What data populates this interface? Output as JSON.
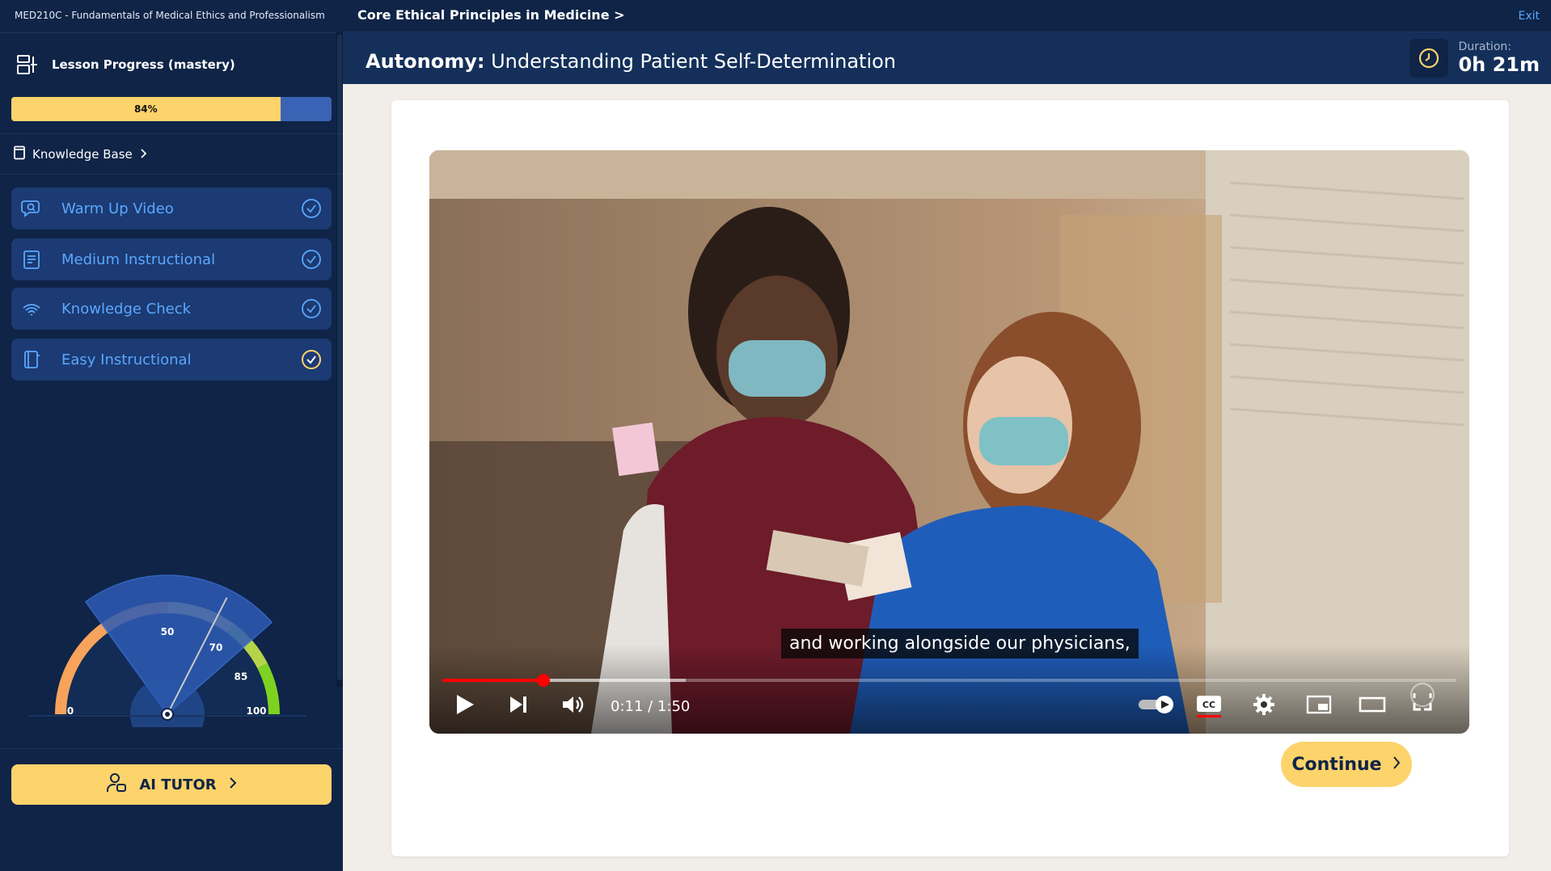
{
  "course": {
    "title": "MED210C - Fundamentals of Medical Ethics and Professionalism"
  },
  "sidebar": {
    "progress_label": "Lesson Progress (mastery)",
    "progress_percent": 84,
    "progress_text": "84%",
    "knowledge_base_label": "Knowledge Base",
    "lessons": [
      {
        "label": "Warm Up Video",
        "icon": "chat-search-icon",
        "completed": true
      },
      {
        "label": "Medium Instructional",
        "icon": "document-list-icon",
        "completed": true
      },
      {
        "label": "Knowledge Check",
        "icon": "fingerprint-icon",
        "completed": true
      },
      {
        "label": "Easy Instructional",
        "icon": "book-icon",
        "completed": true
      }
    ],
    "gauge": {
      "value": 65,
      "min": 0,
      "max": 100,
      "ticks": [
        {
          "label": "0",
          "value": 0
        },
        {
          "label": "50",
          "value": 50
        },
        {
          "label": "70",
          "value": 70
        },
        {
          "label": "85",
          "value": 85
        },
        {
          "label": "100",
          "value": 100
        }
      ],
      "bands": [
        {
          "from": 0,
          "to": 50,
          "color": "#f7a35c"
        },
        {
          "from": 50,
          "to": 70,
          "color": "#fdd36b"
        },
        {
          "from": 70,
          "to": 85,
          "color": "#b5d44a"
        },
        {
          "from": 85,
          "to": 100,
          "color": "#7ed321"
        }
      ],
      "accent_color": "#2e5bb5"
    },
    "ai_tutor_label": "AI TUTOR"
  },
  "topbar": {
    "breadcrumb": "Core Ethical Principles in Medicine >",
    "exit_label": "Exit"
  },
  "header": {
    "title_bold": "Autonomy:",
    "title_rest": "Understanding Patient Self-Determination",
    "duration_label": "Duration:",
    "duration_value": "0h 21m"
  },
  "video": {
    "caption": "and working alongside our physicians,",
    "time_text": "0:11 / 1:50",
    "current_seconds": 11,
    "total_seconds": 110,
    "buffered_fraction": 0.24
  },
  "continue_label": "Continue",
  "colors": {
    "navy": "#0f2447",
    "accent_yellow": "#fdd36b",
    "accent_blue": "#5aa8ff",
    "item_bg": "#1c3a73"
  }
}
